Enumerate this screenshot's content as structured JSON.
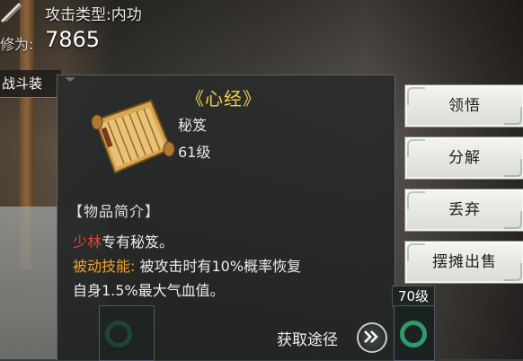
{
  "top": {
    "attack_type": "攻击类型:内功",
    "power_label": "修为:",
    "power_value": "7865",
    "equip_tag": "战斗装"
  },
  "item": {
    "name": "《心经》",
    "type": "秘笈",
    "level": "61级",
    "section_title": "【物品简介】",
    "sect": "少林",
    "sect_suffix": "专有秘笈。",
    "passive_label": "被动技能:",
    "passive_text_line1": "被攻击时有10%概率恢复",
    "passive_text_line2": "自身1.5%最大气血值。",
    "source_label": "获取途径",
    "icon": "scroll-icon"
  },
  "actions": {
    "comprehend": "领悟",
    "decompose": "分解",
    "discard": "丢弃",
    "sell_stall": "摆摊出售"
  },
  "inventory": {
    "level_badge": "70级"
  },
  "colors": {
    "item_name": "#f0d04a",
    "sect": "#e0403a",
    "passive_label": "#f0a030"
  }
}
